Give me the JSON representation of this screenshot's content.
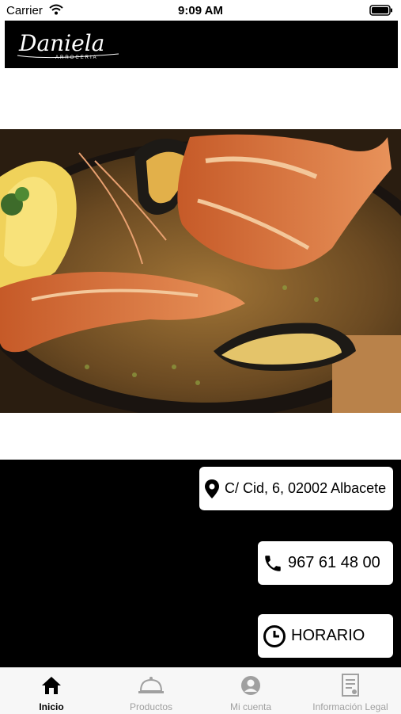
{
  "status_bar": {
    "carrier": "Carrier",
    "time": "9:09 AM"
  },
  "header": {
    "logo_text": "Daniela",
    "logo_subtext": "ARROCERIA"
  },
  "contact": {
    "address": "C/ Cid, 6, 02002 Albacete",
    "phone": "967 61 48 00",
    "hours_label": "HORARIO"
  },
  "tabs": [
    {
      "label": "Inicio",
      "icon": "home-icon",
      "active": true
    },
    {
      "label": "Productos",
      "icon": "service-bell-icon",
      "active": false
    },
    {
      "label": "Mi cuenta",
      "icon": "user-icon",
      "active": false
    },
    {
      "label": "Información Legal",
      "icon": "document-icon",
      "active": false
    }
  ],
  "colors": {
    "header_bg": "#000000",
    "panel_bg": "#000000",
    "tab_active": "#000000",
    "tab_inactive": "#a0a0a0"
  }
}
